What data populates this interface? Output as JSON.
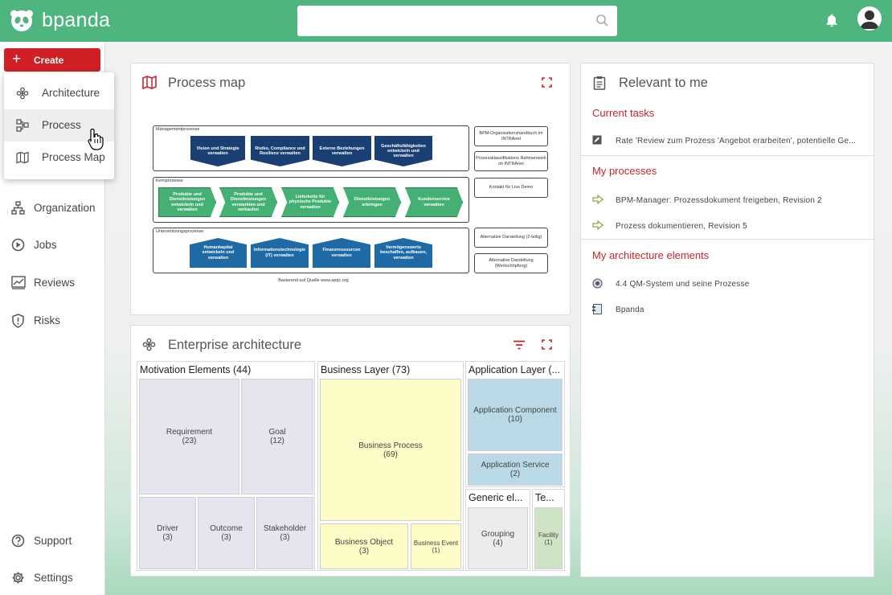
{
  "app": {
    "brand": "bpanda",
    "search": {
      "placeholder": "",
      "value": ""
    }
  },
  "sidebar": {
    "create_label": "Create",
    "items": [
      {
        "label": "Organization",
        "icon": "sitemap-icon"
      },
      {
        "label": "Jobs",
        "icon": "play-circle-icon"
      },
      {
        "label": "Reviews",
        "icon": "review-chart-icon"
      },
      {
        "label": "Risks",
        "icon": "shield-icon"
      }
    ],
    "bottom": [
      {
        "label": "Support",
        "icon": "help-circle-icon"
      },
      {
        "label": "Settings",
        "icon": "gear-icon"
      }
    ]
  },
  "create_menu": {
    "items": [
      {
        "label": "Architecture",
        "icon": "atom-icon"
      },
      {
        "label": "Process",
        "icon": "process-icon"
      },
      {
        "label": "Process Map",
        "icon": "map-icon"
      }
    ]
  },
  "process_map": {
    "title": "Process map",
    "bands": {
      "management": "Managementprozesse",
      "core": "Kernprozesse",
      "support": "Unterstützungsprozesse"
    },
    "management_tiles": [
      "Vision und Strategie verwalten",
      "Risiko, Compliance und Resilienz verwalten",
      "Externe Beziehungen verwalten",
      "Geschäftsfähigkeiten entwickeln und verwalten"
    ],
    "core_tiles": [
      "Produkte und Dienstleistungen entwickeln und verwalten",
      "Produkte und Dienstleistungen vermarkten und verkaufen",
      "Lieferkette für physische Produkte verwalten",
      "Dienstleistungen erbringen",
      "Kundenservice verwalten"
    ],
    "support_tiles": [
      "Humankapital entwickeln und verwalten",
      "Informationstechnologie (IT) verwalten",
      "Finanzressourcen verwalten",
      "Vermögenswerte beschaffen, aufbauen, verwalten"
    ],
    "side_boxes": [
      "BPM-Organisationshandbuch im INTRAnet",
      "Prozessklassifikations Rahmenwerk im INTRAnet",
      "Kontakt für Live Demo",
      "Alternative Darstellung (2-teilig)",
      "Alternative Darstellung (Wertschöpfung)"
    ],
    "source": "Basierend auf Quelle www.apqc.org"
  },
  "enterprise": {
    "title": "Enterprise architecture",
    "groups": {
      "motivation": "Motivation Elements (44)",
      "business": "Business Layer (73)",
      "application": "Application Layer (...",
      "generic": "Generic el...",
      "tech": "Te..."
    },
    "leaves": {
      "requirement": {
        "label": "Requirement",
        "count": "(23)"
      },
      "goal": {
        "label": "Goal",
        "count": "(12)"
      },
      "driver": {
        "label": "Driver",
        "count": "(3)"
      },
      "outcome": {
        "label": "Outcome",
        "count": "(3)"
      },
      "stakeholder": {
        "label": "Stakeholder",
        "count": "(3)"
      },
      "business_process": {
        "label": "Business Process",
        "count": "(69)"
      },
      "business_object": {
        "label": "Business Object",
        "count": "(3)"
      },
      "business_event": {
        "label": "Business Event",
        "count": "(1)"
      },
      "app_component": {
        "label": "Application Component",
        "count": "(10)"
      },
      "app_service": {
        "label": "Application Service",
        "count": "(2)"
      },
      "grouping": {
        "label": "Grouping",
        "count": "(4)"
      },
      "facility": {
        "label": "Facility",
        "count": "(1)"
      }
    }
  },
  "relevant": {
    "title": "Relevant to me",
    "current_tasks": "Current tasks",
    "tasks": [
      "Rate 'Review zum Prozess 'Angebot erarbeiten', potentielle Ge..."
    ],
    "my_processes": "My processes",
    "processes": [
      "BPM-Manager: Prozessdokument freigeben, Revision 2",
      "Prozess dokumentieren, Revision 5"
    ],
    "my_arch": "My architecture elements",
    "arch_items": [
      "4.4 QM-System und seine Prozesse",
      "Bpanda"
    ]
  },
  "colors": {
    "header": "#4db57d",
    "accent": "#d11f26",
    "motivation": "#e4e5ee",
    "business": "#fdfbc6",
    "application": "#b9d9e6",
    "generic": "#ececec",
    "tech": "#cfe3c6"
  }
}
